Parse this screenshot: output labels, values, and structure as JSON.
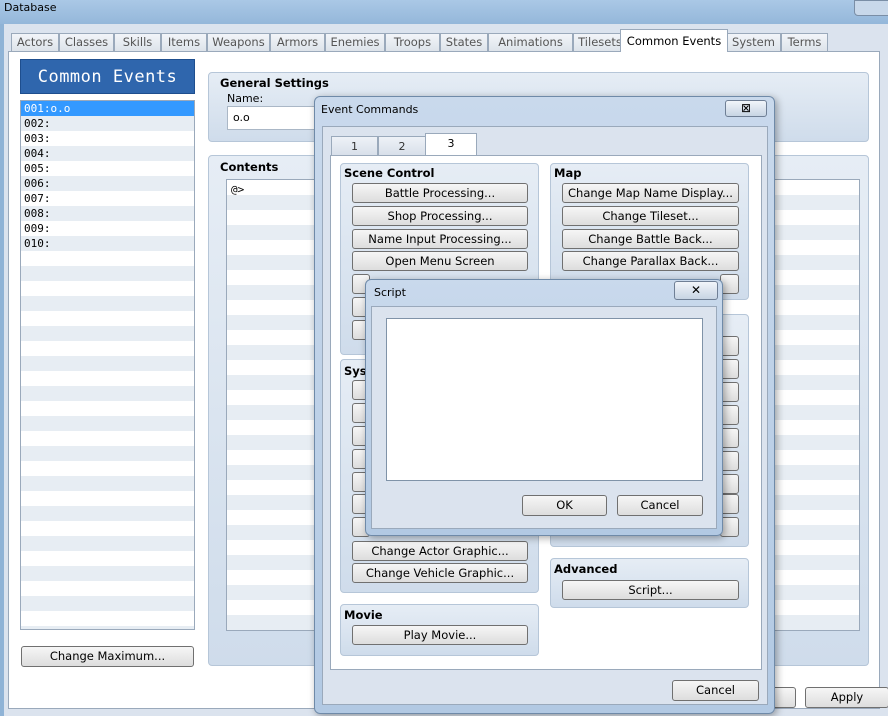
{
  "window": {
    "title": "Database"
  },
  "tabs": [
    "Actors",
    "Classes",
    "Skills",
    "Items",
    "Weapons",
    "Armors",
    "Enemies",
    "Troops",
    "States",
    "Animations",
    "Tilesets",
    "Common Events",
    "System",
    "Terms"
  ],
  "active_tab": "Common Events",
  "common_events": {
    "header": "Common Events",
    "items": [
      "001:o.o",
      "002:",
      "003:",
      "004:",
      "005:",
      "006:",
      "007:",
      "008:",
      "009:",
      "010:"
    ],
    "selected_index": 0,
    "change_max_label": "Change Maximum..."
  },
  "general": {
    "title": "General Settings",
    "name_label": "Name:",
    "name_value": "o.o"
  },
  "contents": {
    "title": "Contents",
    "first_line": "@>"
  },
  "footer": {
    "apply_label": "Apply"
  },
  "event_commands": {
    "title": "Event Commands",
    "close_glyph": "⊠",
    "tabs": [
      "1",
      "2",
      "3"
    ],
    "active_tab": "3",
    "scene_control": {
      "title": "Scene Control",
      "buttons": [
        "Battle Processing...",
        "Shop Processing...",
        "Name Input Processing...",
        "Open Menu Screen"
      ]
    },
    "map": {
      "title": "Map",
      "buttons": [
        "Change Map Name Display...",
        "Change Tileset...",
        "Change Battle Back...",
        "Change Parallax Back..."
      ]
    },
    "system": {
      "title": "Sys",
      "buttons": [
        "Change Actor Graphic...",
        "Change Vehicle Graphic..."
      ]
    },
    "movie": {
      "title": "Movie",
      "button": "Play Movie..."
    },
    "advanced": {
      "title": "Advanced",
      "button": "Script..."
    },
    "cancel_label": "Cancel"
  },
  "script_dialog": {
    "title": "Script",
    "close_glyph": "✕",
    "text_value": "",
    "ok_label": "OK",
    "cancel_label": "Cancel"
  }
}
